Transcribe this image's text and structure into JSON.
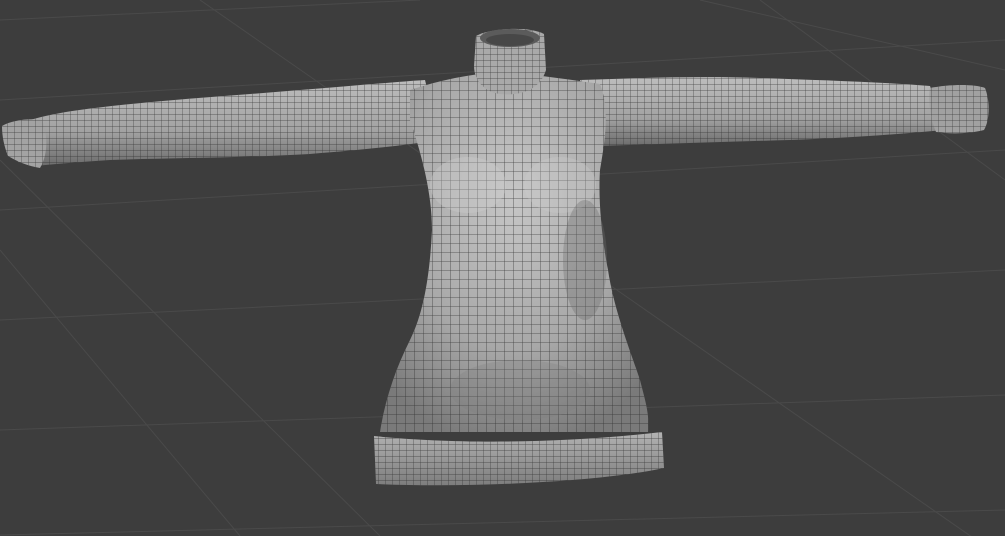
{
  "viewport": {
    "background": "#3d3d3d",
    "grid_color": "#4a4a4a",
    "mesh_base_color": "#a9a9a9",
    "mesh_wire_color": "#2a2a2a",
    "mesh_highlight": "#c4c4c4",
    "mesh_shadow": "#6a6a6a"
  },
  "object": {
    "icon": "mesh-sweater-icon"
  }
}
